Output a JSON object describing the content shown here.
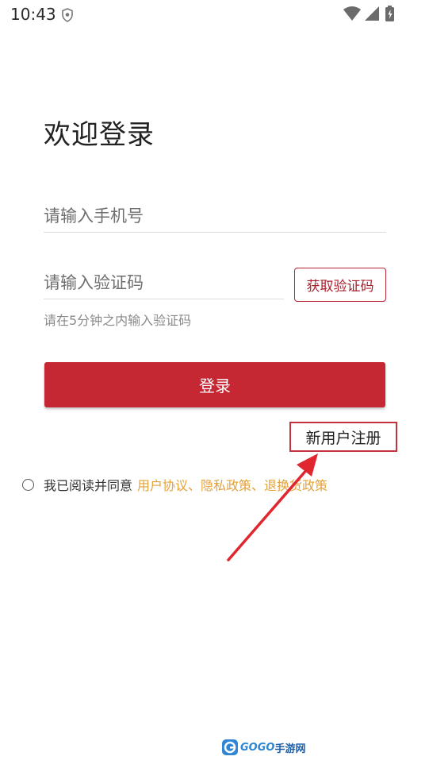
{
  "status_bar": {
    "time": "10:43",
    "icons": [
      "shield-icon",
      "wifi-icon",
      "signal-icon",
      "battery-charging-icon"
    ]
  },
  "login": {
    "title": "欢迎登录",
    "phone_placeholder": "请输入手机号",
    "code_placeholder": "请输入验证码",
    "get_code_label": "获取验证码",
    "hint": "请在5分钟之内输入验证码",
    "login_label": "登录",
    "register_label": "新用户注册",
    "agree_text": "我已阅读并同意",
    "agree_links": "用户协议、隐私政策、退换货政策"
  },
  "colors": {
    "primary": "#c52733",
    "link": "#e4a23a",
    "annotation": "#e0262e"
  },
  "watermark": {
    "brand": "GOGO",
    "brand_cn": "手游网"
  }
}
